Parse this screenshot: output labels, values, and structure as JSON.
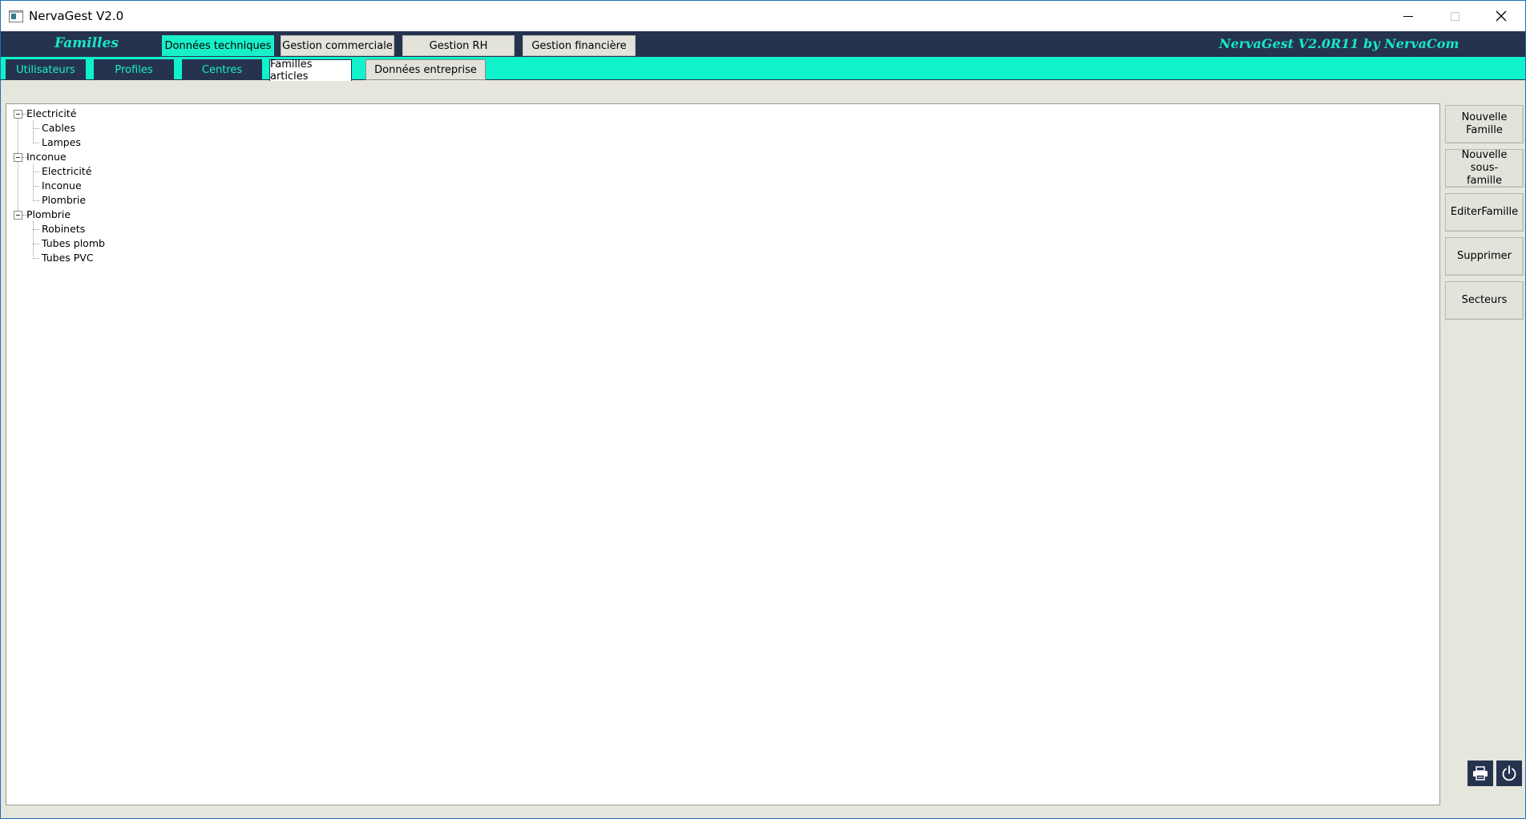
{
  "window": {
    "title": "NervaGest V2.0"
  },
  "header": {
    "section_title": "Familles",
    "brand": "NervaGest V2.0R11 by NervaCom",
    "tabs": [
      {
        "label": "Données techniques",
        "active": true
      },
      {
        "label": "Gestion commerciale",
        "active": false
      },
      {
        "label": "Gestion RH",
        "active": false
      },
      {
        "label": "Gestion financière",
        "active": false
      }
    ]
  },
  "subnav": {
    "tabs": [
      {
        "label": "Utilisateurs",
        "active": false
      },
      {
        "label": "Profiles",
        "active": false
      },
      {
        "label": "Centres",
        "active": false
      },
      {
        "label": "Familles articles",
        "active": true
      },
      {
        "label": "Données entreprise",
        "active": false
      }
    ]
  },
  "tree": {
    "families": [
      {
        "label": "Electricité",
        "expanded": true,
        "children": [
          "Cables",
          "Lampes"
        ]
      },
      {
        "label": "Inconue",
        "expanded": true,
        "children": [
          "Electricité",
          "Inconue",
          "Plombrie"
        ]
      },
      {
        "label": "Plombrie",
        "expanded": true,
        "children": [
          "Robinets",
          "Tubes plomb",
          "Tubes PVC"
        ]
      }
    ]
  },
  "actions": {
    "nouvelle_famille": "Nouvelle Famille",
    "nouvelle_sous_famille": "Nouvelle sous-famille",
    "editer_famille": "EditerFamille",
    "supprimer": "Supprimer",
    "secteurs": "Secteurs"
  },
  "bottom_icons": {
    "print": "printer-icon",
    "power": "power-icon"
  },
  "colors": {
    "nav_dark": "#26334f",
    "accent": "#17f0c9",
    "background": "#e6e6dd"
  }
}
